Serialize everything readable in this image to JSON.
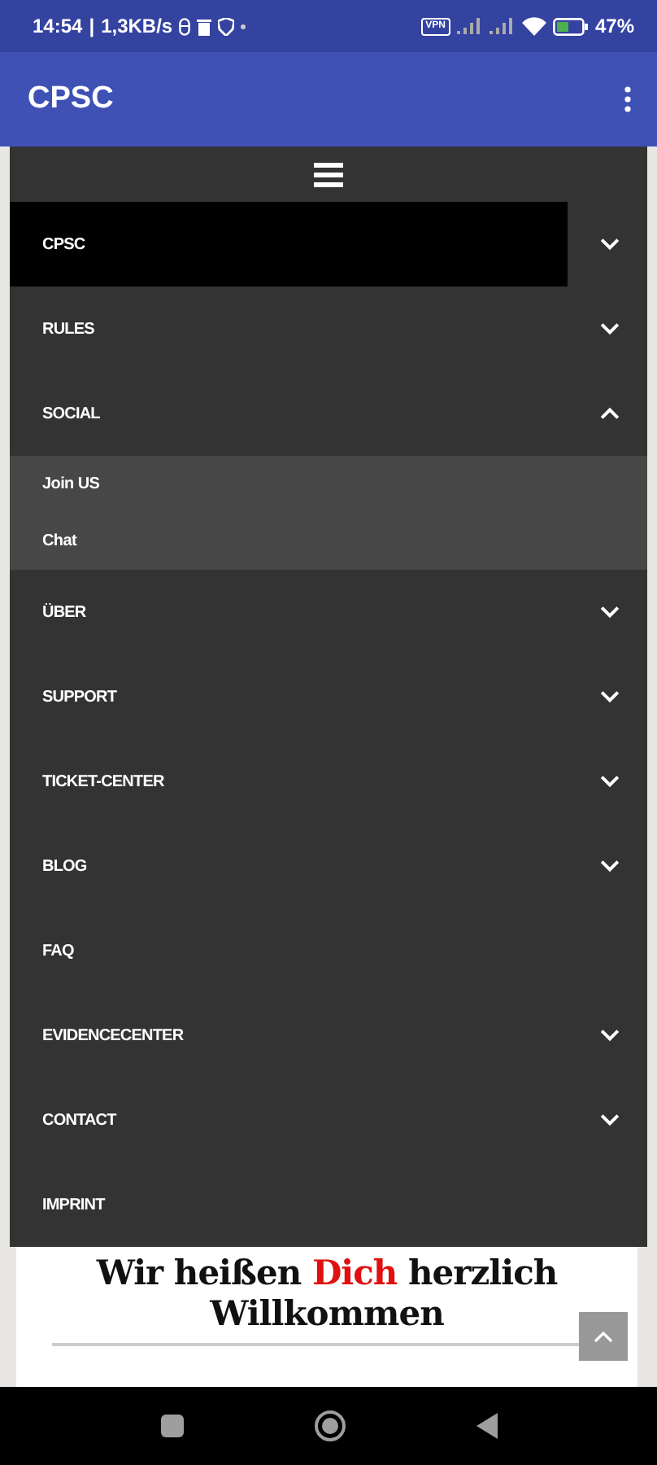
{
  "status_bar": {
    "time": "14:54",
    "separator": "|",
    "speed": "1,3KB/s",
    "vpn": "VPN",
    "battery": "47%"
  },
  "app_bar": {
    "title": "CPSC"
  },
  "menu": {
    "items": [
      {
        "label": "CPSC",
        "kind": "dropdown",
        "selected": true,
        "expanded": false
      },
      {
        "label": "RULES",
        "kind": "dropdown",
        "selected": false,
        "expanded": false
      },
      {
        "label": "SOCIAL",
        "kind": "dropdown",
        "selected": false,
        "expanded": true,
        "children": [
          {
            "label": "Join US"
          },
          {
            "label": "Chat"
          }
        ]
      },
      {
        "label": "ÜBER",
        "kind": "dropdown",
        "selected": false,
        "expanded": false
      },
      {
        "label": "SUPPORT",
        "kind": "dropdown",
        "selected": false,
        "expanded": false
      },
      {
        "label": "TICKET-CENTER",
        "kind": "dropdown",
        "selected": false,
        "expanded": false
      },
      {
        "label": "BLOG",
        "kind": "dropdown",
        "selected": false,
        "expanded": false
      },
      {
        "label": "FAQ",
        "kind": "link",
        "selected": false
      },
      {
        "label": "EVIDENCECENTER",
        "kind": "dropdown",
        "selected": false,
        "expanded": false
      },
      {
        "label": "CONTACT",
        "kind": "dropdown",
        "selected": false,
        "expanded": false
      },
      {
        "label": "IMPRINT",
        "kind": "link",
        "selected": false
      }
    ]
  },
  "heading": {
    "before": "Wir heißen",
    "highlight": "Dich",
    "after": "herzlich Willkommen"
  }
}
